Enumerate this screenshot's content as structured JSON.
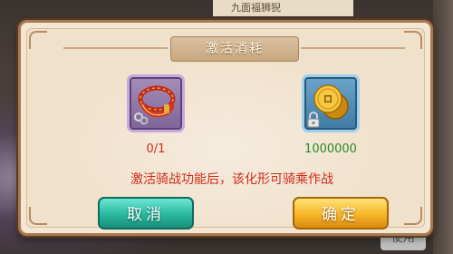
{
  "background": {
    "top_panel_text": "九面福狮猊",
    "right_button_label": "使用"
  },
  "dialog": {
    "title": "激活消耗",
    "items": [
      {
        "icon": "red-rope-icon",
        "count": "0/1",
        "count_color": "#d62b1f"
      },
      {
        "icon": "gold-coins-icon",
        "count": "1000000",
        "count_color": "#2e8a2e",
        "locked": true
      }
    ],
    "description": "激活骑战功能后，该化形可骑乘作战",
    "cancel_label": "取消",
    "confirm_label": "确定"
  }
}
